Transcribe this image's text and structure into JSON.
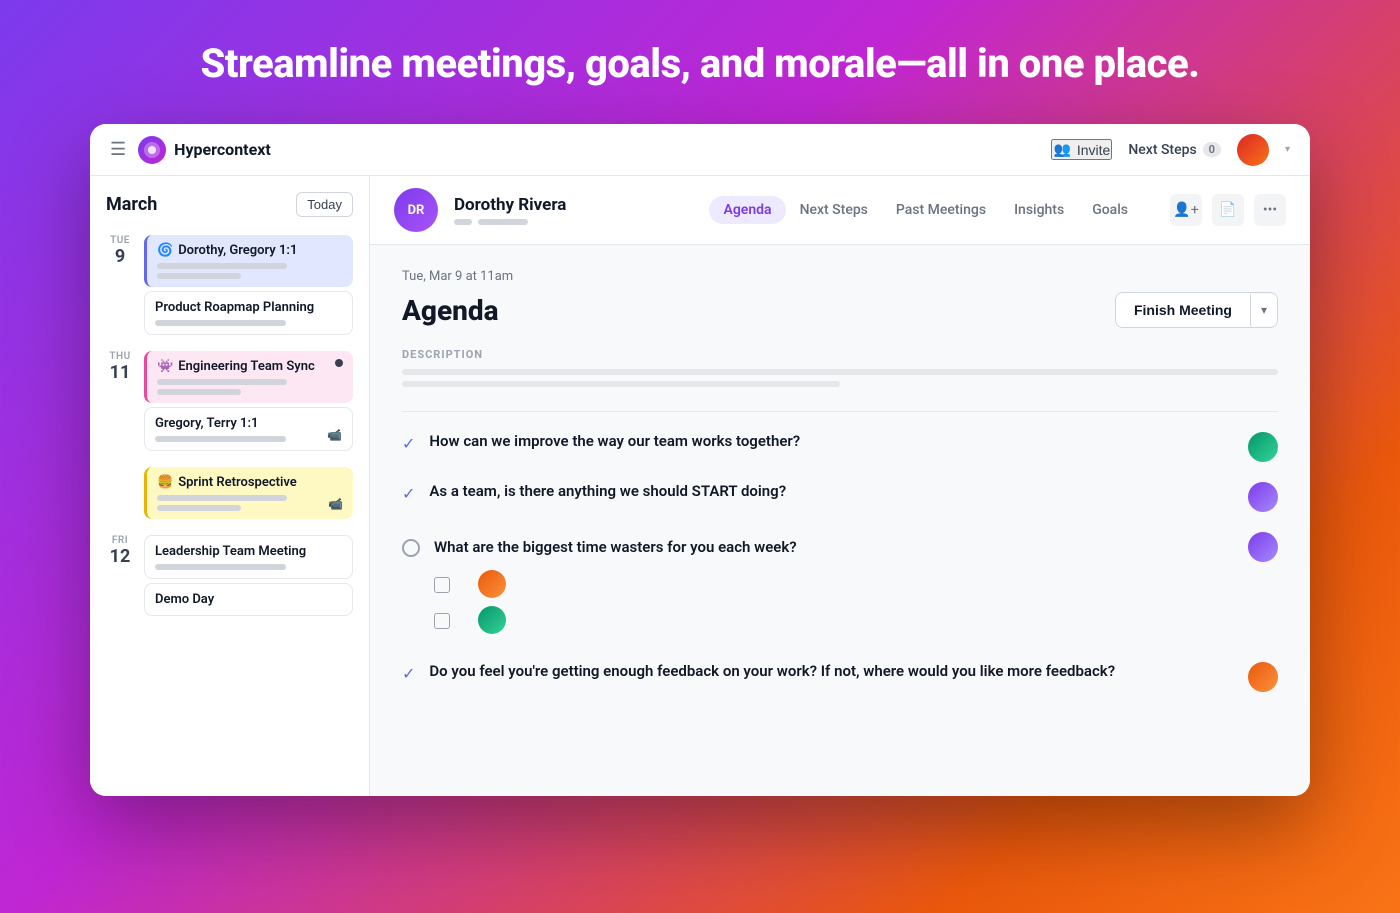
{
  "hero": {
    "title": "Streamline meetings, goals, and morale—all in one place."
  },
  "topnav": {
    "logo": "H",
    "brand": "Hypercontext",
    "invite_label": "Invite",
    "next_steps_label": "Next Steps",
    "next_steps_count": "0"
  },
  "sidebar": {
    "month": "March",
    "today_label": "Today",
    "days": [
      {
        "day_name": "TUE",
        "day_num": "9",
        "events": [
          {
            "title": "Dorothy, Gregory 1:1",
            "type": "purple-active",
            "emoji": "🌀"
          },
          {
            "title": "Product Roapmap Planning",
            "type": "white-card"
          }
        ]
      },
      {
        "day_name": "THU",
        "day_num": "11",
        "events": [
          {
            "title": "Engineering Team Sync",
            "type": "pink-card",
            "emoji": "👾",
            "dot": true
          },
          {
            "title": "Gregory, Terry 1:1",
            "type": "white-card",
            "video": true
          }
        ]
      },
      {
        "day_name": "",
        "day_num": "",
        "events": [
          {
            "title": "Sprint Retrospective",
            "type": "yellow-card",
            "emoji": "🍔",
            "video": true
          }
        ]
      },
      {
        "day_name": "FRI",
        "day_num": "12",
        "events": [
          {
            "title": "Leadership Team Meeting",
            "type": "white-card"
          },
          {
            "title": "Demo Day",
            "type": "white-card"
          }
        ]
      }
    ]
  },
  "meeting_header": {
    "avatar_text": "DR",
    "name": "Dorothy Rivera",
    "tabs": [
      "Agenda",
      "Next Steps",
      "Past Meetings",
      "Insights",
      "Goals"
    ],
    "active_tab": "Agenda"
  },
  "agenda": {
    "date": "Tue, Mar 9 at 11am",
    "title": "Agenda",
    "finish_meeting_label": "Finish Meeting",
    "description_label": "DESCRIPTION",
    "items": [
      {
        "type": "checked",
        "text": "How can we improve the way our team works together?",
        "avatar": "green"
      },
      {
        "type": "checked",
        "text": "As a team, is there anything we should START doing?",
        "avatar": "purple"
      },
      {
        "type": "circle",
        "text": "What are the biggest time wasters for you each week?",
        "avatar": "purple",
        "sub_items": [
          {
            "line_width": "w70",
            "avatar": "orange"
          },
          {
            "line_width": "w50",
            "avatar": "green"
          }
        ]
      },
      {
        "type": "checked",
        "text": "Do you feel you're getting enough feedback on your work? If not, where would you like more feedback?",
        "avatar": "orange"
      }
    ]
  }
}
